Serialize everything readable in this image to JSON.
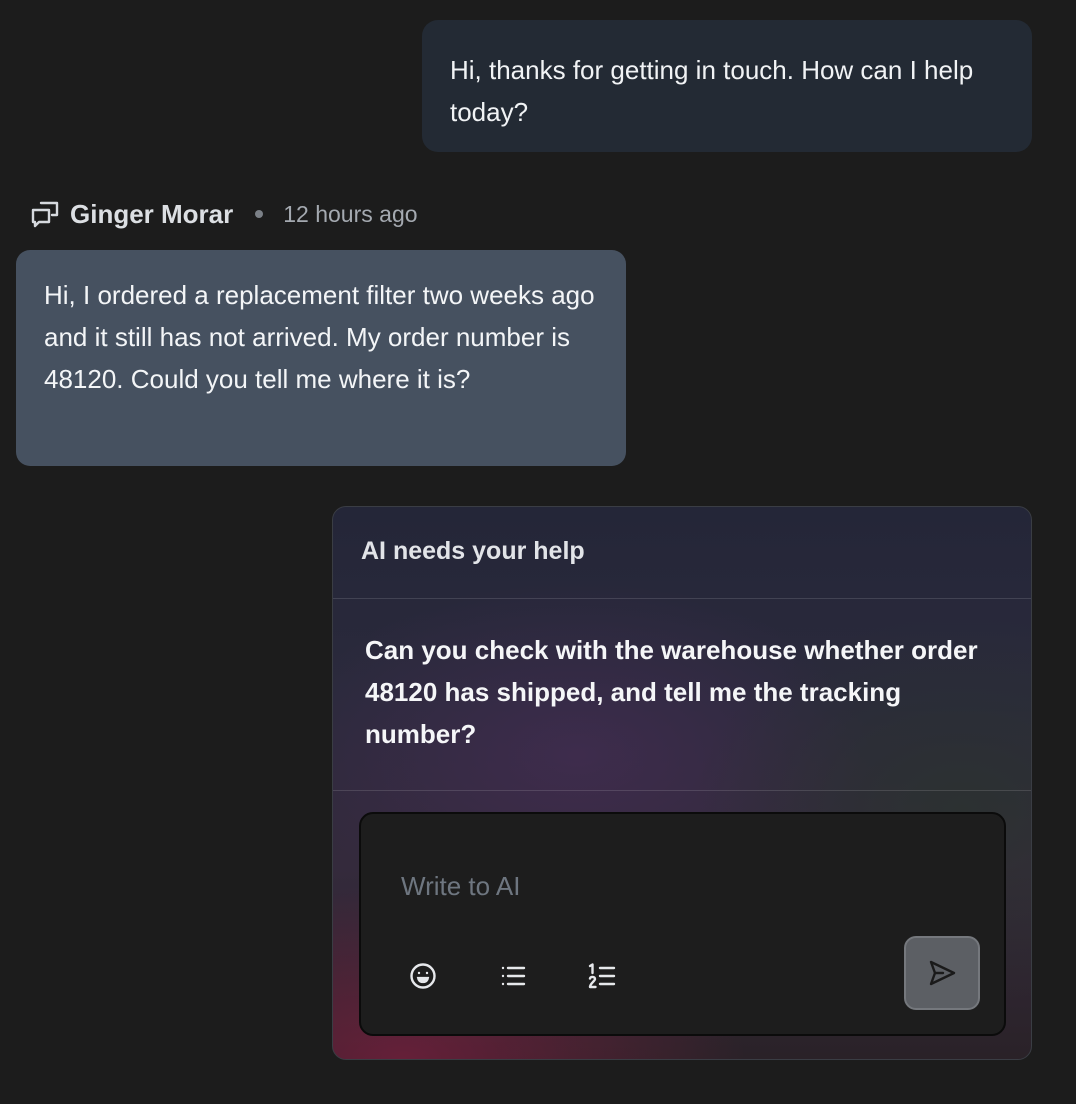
{
  "messages": {
    "agent_reply": "Hi, thanks for getting in touch. How can I help today?",
    "customer": {
      "name": "Ginger Morar",
      "time": "12 hours ago",
      "text": "Hi, I ordered a replacement filter two weeks ago and it still has not arrived. My order number is 48120. Could you tell me where it is?"
    }
  },
  "ai_help": {
    "title": "AI needs your help",
    "question": "Can you check with the warehouse whether order 48120 has shipped, and tell me the tracking number?",
    "composer": {
      "placeholder": "Write to AI",
      "value": "",
      "tools": [
        "emoji-icon",
        "bulleted-list-icon",
        "numbered-list-icon"
      ],
      "send_icon": "send-icon"
    }
  },
  "colors": {
    "background": "#1c1c1c",
    "agent_bubble": "#232a34",
    "customer_bubble": "#465160",
    "send_button": "#5c5f64"
  }
}
